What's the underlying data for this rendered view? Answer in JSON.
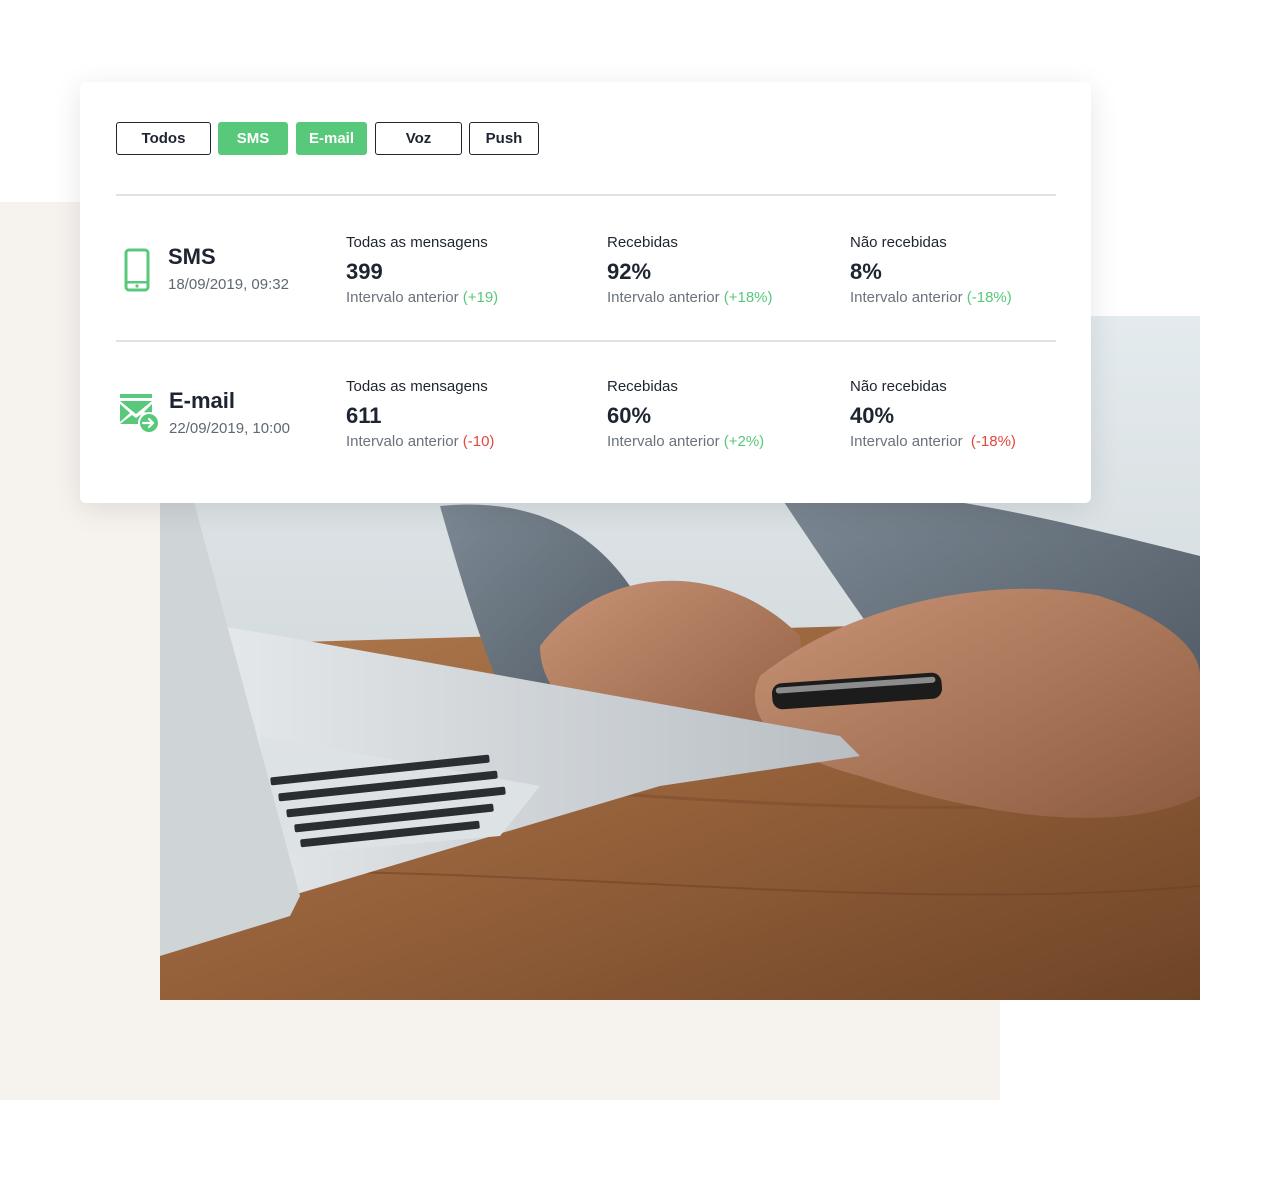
{
  "filters": [
    {
      "label": "Todos",
      "active": false
    },
    {
      "label": "SMS",
      "active": true
    },
    {
      "label": "E-mail",
      "active": true
    },
    {
      "label": "Voz",
      "active": false
    },
    {
      "label": "Push",
      "active": false
    }
  ],
  "colors": {
    "accent": "#58c87a",
    "negative": "#e2483b",
    "text": "#1e2430"
  },
  "rows": [
    {
      "icon": "smartphone-icon",
      "name": "SMS",
      "date": "18/09/2019, 09:32",
      "metrics": [
        {
          "label": "Todas as mensagens",
          "value": "399",
          "prev_label": "Intervalo anterior",
          "delta": "(+19)",
          "trend": "positive"
        },
        {
          "label": "Recebidas",
          "value": "92%",
          "prev_label": "Intervalo anterior",
          "delta": "(+18%)",
          "trend": "positive"
        },
        {
          "label": "Não recebidas",
          "value": "8%",
          "prev_label": "Intervalo anterior",
          "delta": "(-18%)",
          "trend": "positive"
        }
      ]
    },
    {
      "icon": "email-send-icon",
      "name": "E-mail",
      "date": "22/09/2019, 10:00",
      "metrics": [
        {
          "label": "Todas as mensagens",
          "value": "611",
          "prev_label": "Intervalo anterior",
          "delta": "(-10)",
          "trend": "negative"
        },
        {
          "label": "Recebidas",
          "value": "60%",
          "prev_label": "Intervalo anterior",
          "delta": "(+2%)",
          "trend": "positive"
        },
        {
          "label": "Não recebidas",
          "value": "40%",
          "prev_label": "Intervalo anterior",
          "delta": "(-18%)",
          "trend": "negative"
        }
      ]
    }
  ]
}
